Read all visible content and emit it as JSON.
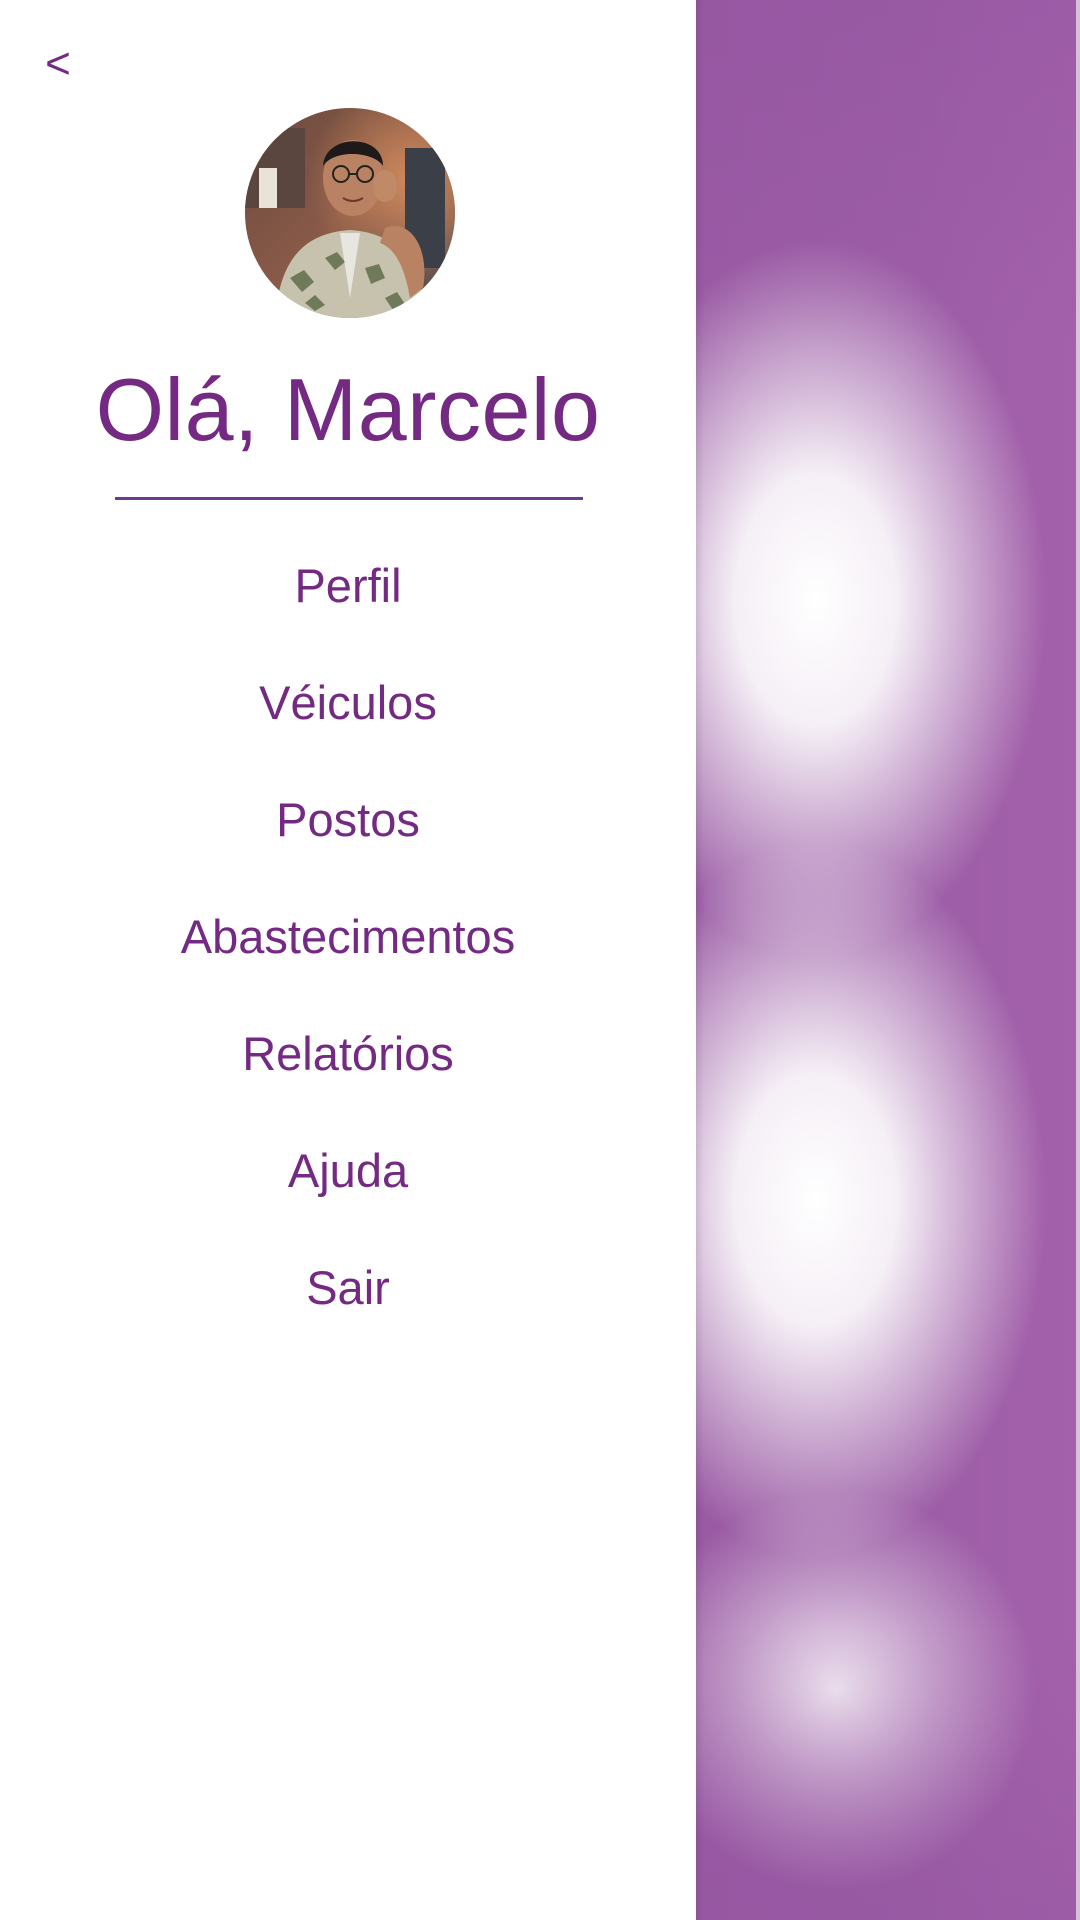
{
  "header": {
    "back_label": "<"
  },
  "user": {
    "greeting": "Olá, Marcelo",
    "avatar": "avatar-photo"
  },
  "menu": {
    "items": [
      {
        "label": "Perfil"
      },
      {
        "label": "Véiculos"
      },
      {
        "label": "Postos"
      },
      {
        "label": "Abastecimentos"
      },
      {
        "label": "Relatórios"
      },
      {
        "label": "Ajuda"
      },
      {
        "label": "Sair"
      }
    ]
  },
  "colors": {
    "accent": "#742a83",
    "divider": "#6e3a96",
    "backdrop": "#9d5ea7"
  }
}
